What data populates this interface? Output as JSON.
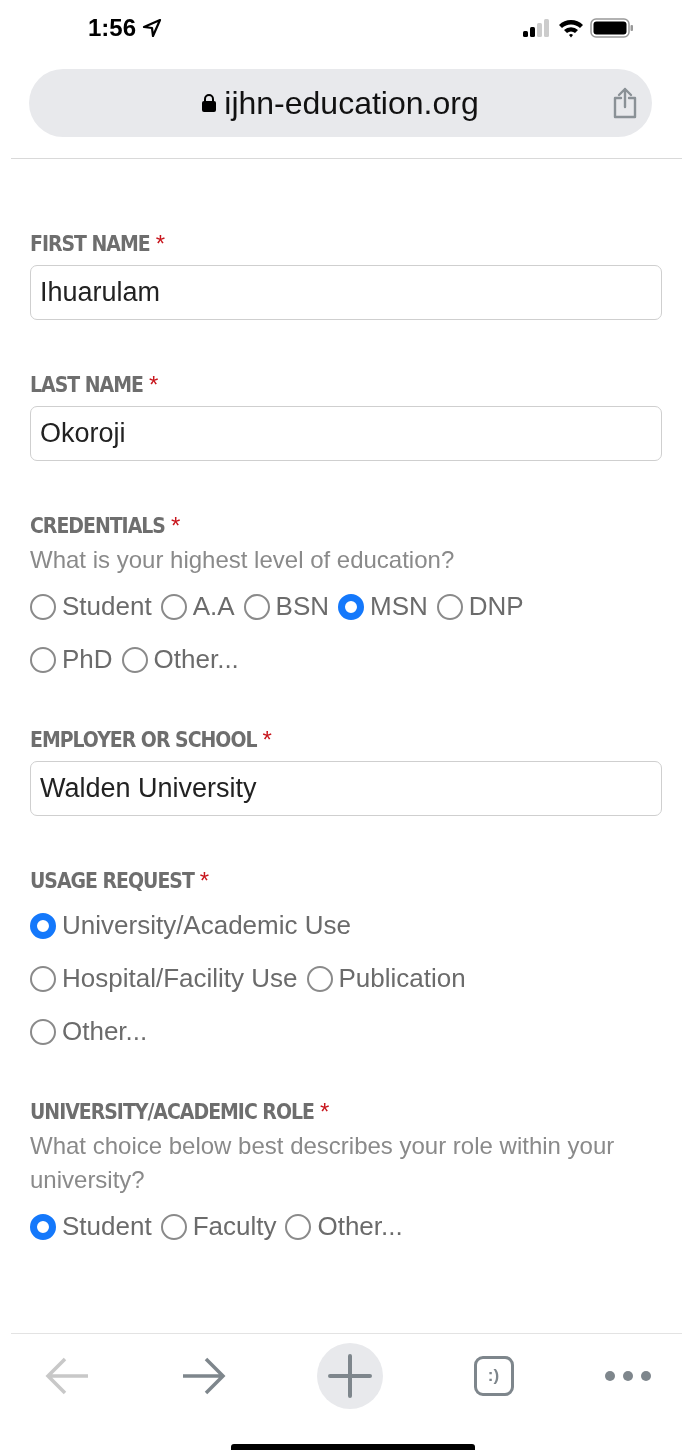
{
  "status_bar": {
    "time": "1:56"
  },
  "address_bar": {
    "url": "ijhn-education.org"
  },
  "form": {
    "fields": [
      {
        "kind": "text",
        "label": "FIRST NAME",
        "required_mark": "*",
        "value": "Ihuarulam"
      },
      {
        "kind": "text",
        "label": "LAST NAME",
        "required_mark": "*",
        "value": "Okoroji"
      },
      {
        "kind": "radio",
        "label": "CREDENTIALS",
        "required_mark": "*",
        "hint": "What is your highest level of education?",
        "options": [
          {
            "label": "Student",
            "selected": false
          },
          {
            "label": "A.A",
            "selected": false
          },
          {
            "label": "BSN",
            "selected": false
          },
          {
            "label": "MSN",
            "selected": true
          },
          {
            "label": "DNP",
            "selected": false
          },
          {
            "label": "PhD",
            "selected": false
          },
          {
            "label": "Other...",
            "selected": false
          }
        ]
      },
      {
        "kind": "text",
        "label": "EMPLOYER OR SCHOOL",
        "required_mark": "*",
        "value": "Walden University"
      },
      {
        "kind": "radio",
        "label": "USAGE REQUEST",
        "required_mark": "*",
        "options": [
          {
            "label": "University/Academic Use",
            "selected": true
          },
          {
            "label": "Hospital/Facility Use",
            "selected": false
          },
          {
            "label": "Publication",
            "selected": false
          },
          {
            "label": "Other...",
            "selected": false
          }
        ]
      },
      {
        "kind": "radio",
        "label": "UNIVERSITY/ACADEMIC ROLE",
        "required_mark": "*",
        "hint": "What choice below best describes your role within your university?",
        "options": [
          {
            "label": "Student",
            "selected": true
          },
          {
            "label": "Faculty",
            "selected": false
          },
          {
            "label": "Other...",
            "selected": false
          }
        ]
      }
    ]
  },
  "toolbar": {
    "back_disabled": true,
    "tabs_label": ":)"
  }
}
